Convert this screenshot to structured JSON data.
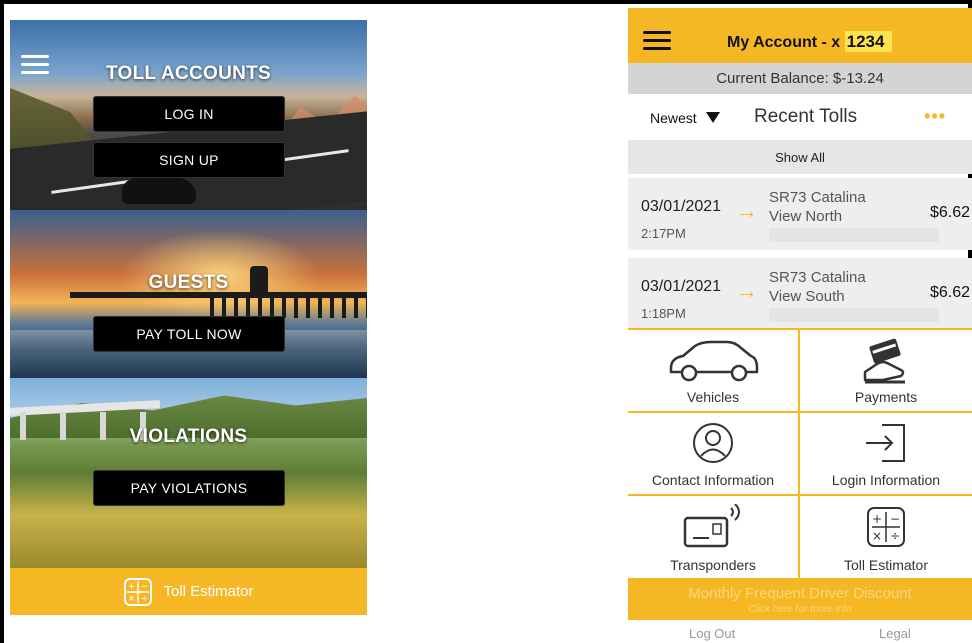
{
  "left_app": {
    "menu_icon": "hamburger-menu-icon",
    "toll_accounts": {
      "title": "TOLL ACCOUNTS",
      "login_label": "LOG IN",
      "signup_label": "SIGN UP"
    },
    "guests": {
      "title": "GUESTS",
      "pay_toll_label": "PAY TOLL NOW"
    },
    "violations": {
      "title": "VIOLATIONS",
      "pay_violations_label": "PAY VIOLATIONS"
    },
    "footer": {
      "icon": "calculator-icon",
      "label": "Toll Estimator"
    }
  },
  "right_app": {
    "header": {
      "menu_icon": "hamburger-menu-icon",
      "title_prefix": "My Account - x ",
      "account_number": "1234"
    },
    "balance": "Current Balance: $-13.24",
    "sort": {
      "label": "Newest",
      "title": "Recent Tolls",
      "more": "•••"
    },
    "show_all": "Show All",
    "tolls": [
      {
        "date": "03/01/2021",
        "time": "2:17PM",
        "location_line1": "SR73 Catalina",
        "location_line2": "View North",
        "amount": "$6.62"
      },
      {
        "date": "03/01/2021",
        "time": "1:18PM",
        "location_line1": "SR73 Catalina",
        "location_line2": "View South",
        "amount": "$6.62"
      }
    ],
    "grid": [
      {
        "label": "Vehicles",
        "icon": "car-icon"
      },
      {
        "label": "Payments",
        "icon": "credit-card-hand-icon"
      },
      {
        "label": "Contact Information",
        "icon": "user-circle-icon"
      },
      {
        "label": "Login Information",
        "icon": "login-arrow-icon"
      },
      {
        "label": "Transponders",
        "icon": "transponder-icon"
      },
      {
        "label": "Toll Estimator",
        "icon": "calculator-icon"
      }
    ],
    "discount": {
      "title": "Monthly Frequent Driver Discount",
      "subtitle": "Click here for more info"
    },
    "footer": {
      "logout": "Log Out",
      "legal": "Legal"
    }
  },
  "colors": {
    "brand_yellow": "#f6b724",
    "button_black": "#000000",
    "balance_gray": "#d4d4d4"
  }
}
